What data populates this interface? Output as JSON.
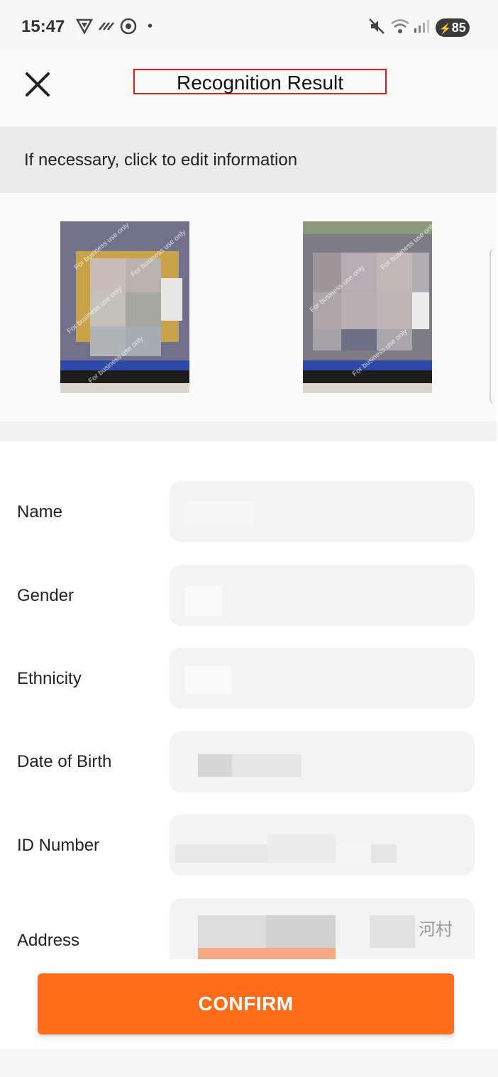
{
  "status_bar": {
    "time": "15:47",
    "battery": "85",
    "icons": [
      "shield-icon",
      "signal-swirl-icon",
      "vpn-icon",
      "dot-icon",
      "mute-icon",
      "wifi-icon",
      "cell-signal-icon",
      "battery-charging-icon"
    ]
  },
  "header": {
    "title": "Recognition Result",
    "close_icon": "close-icon",
    "highlight_color": "#e51b1b"
  },
  "hint": {
    "text": "If necessary, click to edit information"
  },
  "photos": [
    {
      "name": "id-card-front"
    },
    {
      "name": "id-card-back"
    }
  ],
  "form": {
    "fields": [
      {
        "label": "Name",
        "value": ""
      },
      {
        "label": "Gender",
        "value": ""
      },
      {
        "label": "Ethnicity",
        "value": ""
      },
      {
        "label": "Date of Birth",
        "value": ""
      },
      {
        "label": "ID Number",
        "value": ""
      },
      {
        "label": "Address",
        "value": "河村"
      }
    ]
  },
  "footer": {
    "confirm_label": "CONFIRM",
    "accent_color": "#ff6d1a"
  }
}
